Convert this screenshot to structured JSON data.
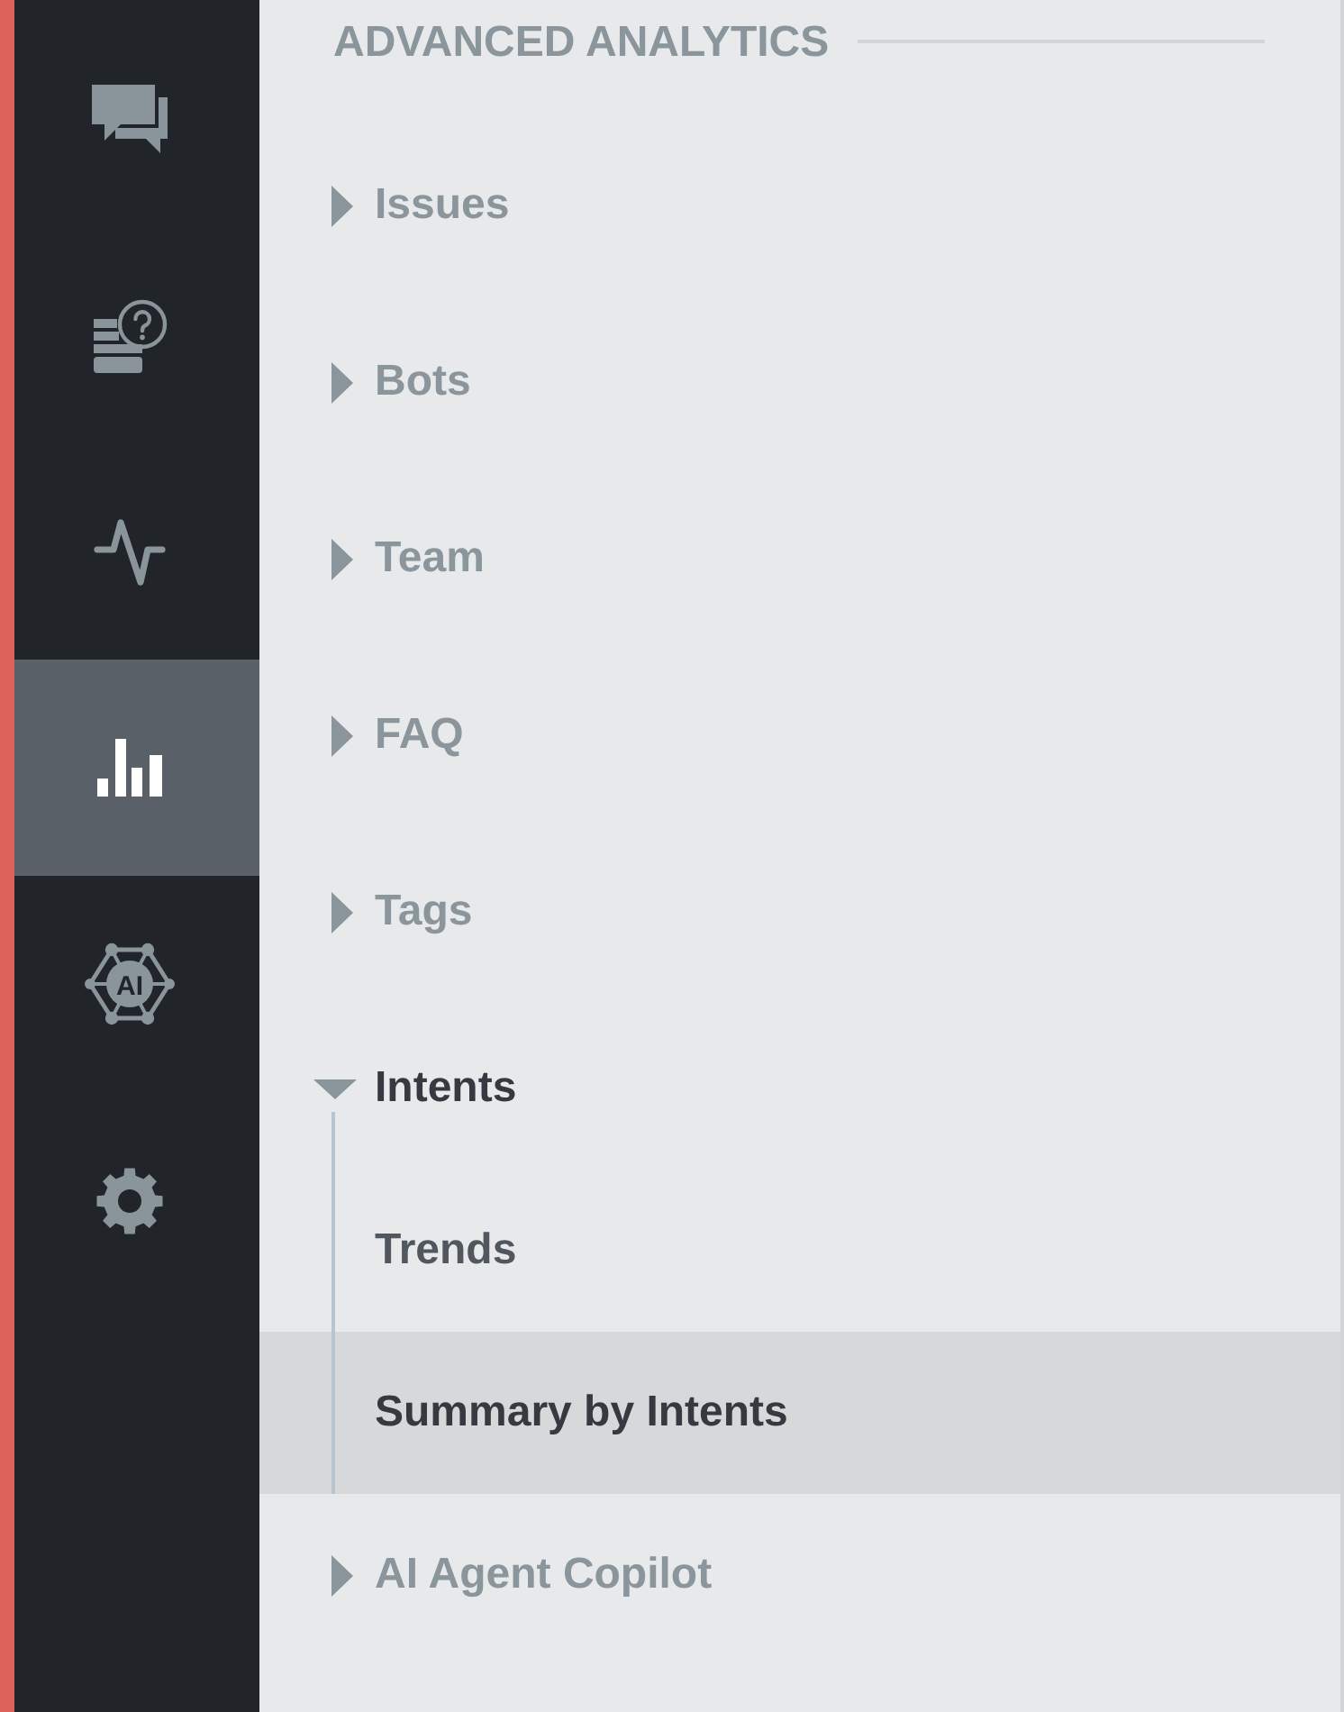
{
  "rail": {
    "items": [
      {
        "kind": "chat",
        "selected": false
      },
      {
        "kind": "faq",
        "selected": false
      },
      {
        "kind": "pulse",
        "selected": false
      },
      {
        "kind": "analytics",
        "selected": true
      },
      {
        "kind": "ai",
        "label": "AI",
        "selected": false
      },
      {
        "kind": "settings",
        "selected": false
      }
    ]
  },
  "panel": {
    "heading": "ADVANCED ANALYTICS",
    "items": [
      {
        "label": "Issues",
        "expanded": false
      },
      {
        "label": "Bots",
        "expanded": false
      },
      {
        "label": "Team",
        "expanded": false
      },
      {
        "label": "FAQ",
        "expanded": false
      },
      {
        "label": "Tags",
        "expanded": false
      },
      {
        "label": "Intents",
        "expanded": true,
        "children": [
          {
            "label": "Trends",
            "selected": false
          },
          {
            "label": "Summary by Intents",
            "selected": true
          }
        ]
      },
      {
        "label": "AI Agent Copilot",
        "expanded": false
      }
    ]
  }
}
